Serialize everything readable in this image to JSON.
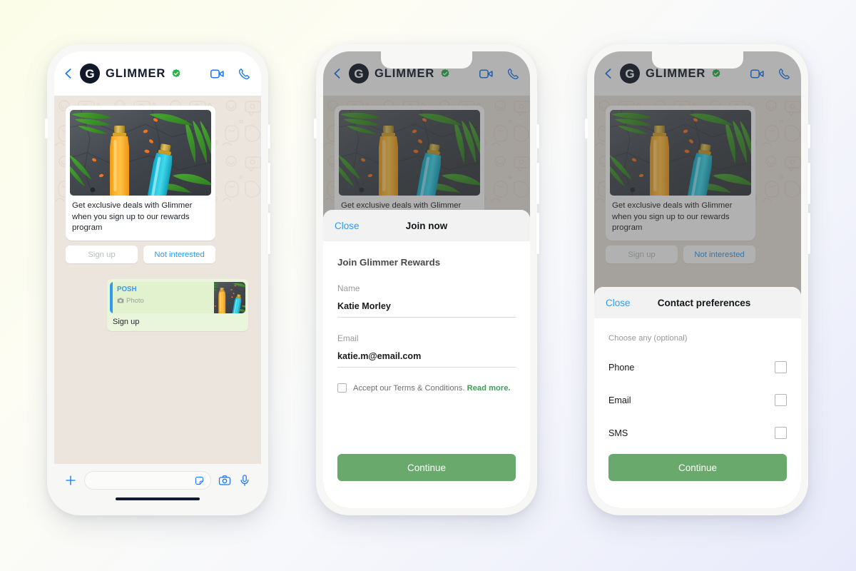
{
  "background": {
    "gradient_from": "#fbfde8",
    "gradient_to": "#e8eafb"
  },
  "colors": {
    "accent_blue": "#2e9bf0",
    "brand_dark": "#131a2b",
    "verified_green": "#2bb24c",
    "continue_green": "#69a96b",
    "link_green": "#3d9e55",
    "chat_wallpaper": "#ece5dd",
    "outgoing_bubble": "#eaf6dc"
  },
  "chat": {
    "header": {
      "back_icon": "chevron-left-icon",
      "avatar_letter": "G",
      "brand": "GLIMMER",
      "verified_icon": "verified-badge-icon",
      "video_icon": "video-call-icon",
      "phone_icon": "phone-call-icon"
    },
    "message": {
      "image_alt": "shampoo-bottles-photo",
      "text": "Get exclusive deals with Glimmer when you sign up to our rewards program",
      "buttons": [
        {
          "label": "Sign up",
          "state": "disabled"
        },
        {
          "label": "Not interested",
          "state": "link"
        }
      ]
    },
    "reply": {
      "quote_title": "POSH",
      "quote_icon": "camera-icon",
      "quote_subtitle": "Photo",
      "text": "Sign up"
    },
    "footer": {
      "plus_icon": "plus-icon",
      "input_placeholder": "",
      "input_value": "",
      "sticker_icon": "sticker-icon",
      "camera_icon": "camera-icon",
      "mic_icon": "microphone-icon"
    }
  },
  "join_sheet": {
    "close_label": "Close",
    "title": "Join now",
    "heading": "Join Glimmer Rewards",
    "fields": [
      {
        "label": "Name",
        "value": "Katie Morley"
      },
      {
        "label": "Email",
        "value": "katie.m@email.com"
      }
    ],
    "terms_text": "Accept our Terms & Conditions.",
    "terms_link": "Read more.",
    "terms_checked": false,
    "continue_label": "Continue"
  },
  "prefs_sheet": {
    "close_label": "Close",
    "title": "Contact preferences",
    "hint": "Choose any (optional)",
    "options": [
      {
        "label": "Phone",
        "checked": false
      },
      {
        "label": "Email",
        "checked": false
      },
      {
        "label": "SMS",
        "checked": false
      }
    ],
    "continue_label": "Continue"
  }
}
